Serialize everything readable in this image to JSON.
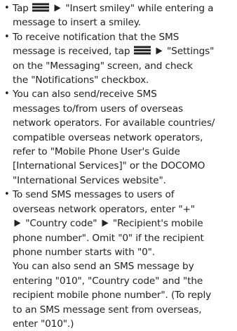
{
  "icons": {
    "menu": "menu-key-icon",
    "arrow": "right-triangle-arrow-icon"
  },
  "bullets": [
    {
      "lines": [
        [
          "Tap ",
          "{menu}",
          " ",
          "{arrow}",
          " \"Insert smiley\" while entering a"
        ],
        [
          "message to insert a smiley."
        ]
      ]
    },
    {
      "lines": [
        [
          "To receive notification that the SMS"
        ],
        [
          "message is received, tap ",
          "{menu}",
          " ",
          "{arrow}",
          " \"Settings\""
        ],
        [
          "on the \"Messaging\" screen, and check"
        ],
        [
          "the \"Notifications\" checkbox."
        ]
      ]
    },
    {
      "lines": [
        [
          "You can also send/receive SMS"
        ],
        [
          "messages to/from users of overseas"
        ],
        [
          "network operators. For available countries/"
        ],
        [
          "compatible overseas network operators,"
        ],
        [
          "refer to \"Mobile Phone User's Guide"
        ],
        [
          "[International Services]\" or the DOCOMO"
        ],
        [
          "\"International Services website\"."
        ]
      ]
    },
    {
      "lines": [
        [
          "To send SMS messages to users of"
        ],
        [
          "overseas network operators, enter \"+\""
        ],
        [
          "{arrow}",
          " \"Country code\" ",
          "{arrow}",
          " \"Recipient's mobile"
        ],
        [
          "phone number\". Omit \"0\" if the recipient"
        ],
        [
          "phone number starts with \"0\"."
        ],
        [
          "You can also send an SMS message by"
        ],
        [
          "entering \"010\", \"Country code\" and \"the"
        ],
        [
          "recipient mobile phone number\". (To reply"
        ],
        [
          "to an SMS message sent from overseas,"
        ],
        [
          "enter \"010\".)"
        ]
      ]
    }
  ]
}
